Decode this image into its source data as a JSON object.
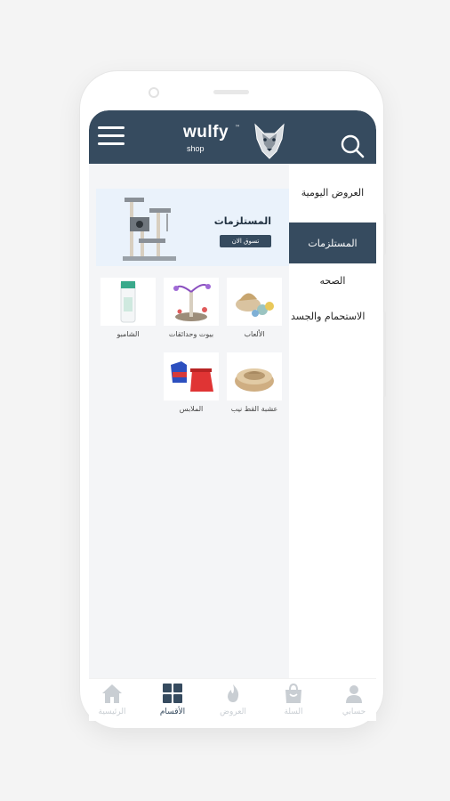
{
  "header": {
    "brand": "wulfy",
    "brand_sub": "shop",
    "brand_tm": "™",
    "menu_icon": "hamburger-menu-icon",
    "search_icon": "search-icon",
    "color": "#364b5f"
  },
  "sidebar": {
    "items": [
      {
        "label": "العروض اليومية",
        "active": false
      },
      {
        "label": "المستلزمات",
        "active": true
      },
      {
        "label": "الصحه",
        "active": false
      },
      {
        "label": "الاستحمام والجسد",
        "active": false
      }
    ]
  },
  "banner": {
    "title": "المستلزمات",
    "button": "تسوق الان"
  },
  "products": [
    {
      "label": "الألعاب",
      "icon": "toy-balls-icon"
    },
    {
      "label": "بيوت وحدائقات",
      "icon": "cat-tree-icon"
    },
    {
      "label": "الشامبو",
      "icon": "shampoo-bottle-icon"
    },
    {
      "label": "عشبة القط نيب",
      "icon": "catnip-bowl-icon"
    },
    {
      "label": "الملابس",
      "icon": "pet-clothes-icon"
    }
  ],
  "bottom_nav": {
    "items": [
      {
        "label": "حسابي",
        "icon": "user-icon",
        "active": false
      },
      {
        "label": "السلة",
        "icon": "shopping-bag-icon",
        "active": false
      },
      {
        "label": "العروض",
        "icon": "flame-icon",
        "active": false
      },
      {
        "label": "الأقسام",
        "icon": "categories-grid-icon",
        "active": true
      },
      {
        "label": "الرئيسية",
        "icon": "home-icon",
        "active": false
      }
    ]
  }
}
